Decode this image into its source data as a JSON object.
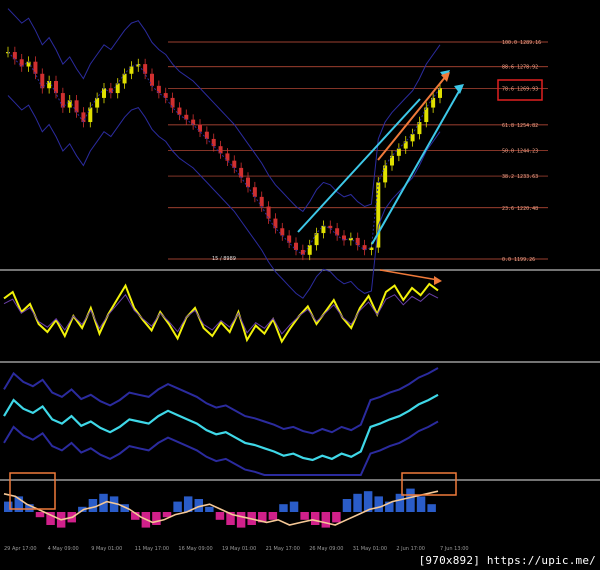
{
  "watermark": "[970x892] https://upic.me/",
  "colors": {
    "background": "#000000",
    "fib_line": "#d2553f",
    "fib_text": "#f4a48a",
    "fib_highlight_box": "#e02020",
    "price_candle_up": "#e0e000",
    "price_candle_down": "#d03030",
    "bollinger": "#2b2b9e",
    "channel_lines": "#3ec8e8",
    "arrow_orange": "#f07a3a",
    "osc_line": "#f2f20a",
    "cyan_line": "#3fd8e8",
    "orange_box": "#f07a3a",
    "panel_divider": "#9a9a9a",
    "hist_blue": "#2a5cc8",
    "hist_magenta": "#d0208a",
    "macd_line": "#f5c896"
  },
  "chart_data": {
    "type": "line",
    "fib_levels": [
      {
        "label": "100.0 1289.16",
        "price": 1289.16
      },
      {
        "label": "88.6 1278.92",
        "price": 1278.92
      },
      {
        "label": "78.6 1269.93",
        "price": 1269.93,
        "highlight": true
      },
      {
        "label": "61.8 1254.82",
        "price": 1254.82
      },
      {
        "label": "50.0 1244.23",
        "price": 1244.23
      },
      {
        "label": "38.2 1233.63",
        "price": 1233.63
      },
      {
        "label": "23.6 1220.48",
        "price": 1220.48
      },
      {
        "label": "0.0 1199.26",
        "price": 1199.26
      }
    ],
    "annotation_text": "15 / 8989",
    "x_labels": [
      "29 Apr 17:00",
      "4 May 09:00",
      "9 May 01:00",
      "11 May 17:00",
      "16 May 09:00",
      "19 May 01:00",
      "21 May 17:00",
      "26 May 09:00",
      "31 May 01:00",
      "2 Jun 17:00",
      "7 Jun 13:00"
    ],
    "price_close": [
      1285,
      1282,
      1279,
      1281,
      1276,
      1270,
      1273,
      1268,
      1262,
      1265,
      1260,
      1256,
      1262,
      1266,
      1270,
      1268,
      1272,
      1276,
      1279,
      1280,
      1276,
      1271,
      1268,
      1266,
      1262,
      1259,
      1257,
      1255,
      1252,
      1249,
      1246,
      1243,
      1240,
      1237,
      1233,
      1229,
      1225,
      1221,
      1216,
      1212,
      1209,
      1206,
      1203,
      1201,
      1205,
      1210,
      1213,
      1212,
      1209,
      1207,
      1208,
      1205,
      1203,
      1204,
      1231,
      1238,
      1242,
      1245,
      1248,
      1251,
      1256,
      1262,
      1266,
      1270
    ],
    "oscillator": [
      0.72,
      0.8,
      0.55,
      0.65,
      0.4,
      0.3,
      0.45,
      0.25,
      0.5,
      0.35,
      0.6,
      0.28,
      0.52,
      0.7,
      0.88,
      0.6,
      0.45,
      0.32,
      0.55,
      0.4,
      0.22,
      0.48,
      0.6,
      0.35,
      0.25,
      0.42,
      0.3,
      0.55,
      0.2,
      0.38,
      0.28,
      0.46,
      0.18,
      0.35,
      0.5,
      0.62,
      0.4,
      0.55,
      0.7,
      0.48,
      0.35,
      0.6,
      0.75,
      0.52,
      0.8,
      0.88,
      0.7,
      0.85,
      0.76,
      0.9,
      0.82
    ],
    "cyan_series": [
      0.55,
      0.7,
      0.62,
      0.58,
      0.64,
      0.52,
      0.48,
      0.55,
      0.46,
      0.5,
      0.44,
      0.4,
      0.45,
      0.52,
      0.5,
      0.48,
      0.55,
      0.6,
      0.56,
      0.52,
      0.48,
      0.42,
      0.38,
      0.4,
      0.35,
      0.3,
      0.28,
      0.25,
      0.22,
      0.18,
      0.2,
      0.16,
      0.14,
      0.18,
      0.15,
      0.2,
      0.17,
      0.22,
      0.45,
      0.48,
      0.52,
      0.55,
      0.6,
      0.66,
      0.7,
      0.75
    ],
    "histogram": [
      0.4,
      0.6,
      0.3,
      -0.2,
      -0.5,
      -0.6,
      -0.4,
      0.2,
      0.5,
      0.7,
      0.6,
      0.3,
      -0.3,
      -0.6,
      -0.5,
      -0.2,
      0.4,
      0.6,
      0.5,
      0.2,
      -0.3,
      -0.5,
      -0.6,
      -0.5,
      -0.4,
      -0.3,
      0.3,
      0.4,
      -0.3,
      -0.5,
      -0.6,
      -0.4,
      0.5,
      0.7,
      0.8,
      0.6,
      0.4,
      0.7,
      0.9,
      0.6,
      0.3
    ],
    "macd_line": [
      0.7,
      0.6,
      0.3,
      0.1,
      -0.1,
      -0.3,
      -0.2,
      0.1,
      0.2,
      0.4,
      0.3,
      0.1,
      -0.2,
      -0.4,
      -0.3,
      -0.1,
      0.0,
      0.2,
      0.3,
      0.1,
      -0.1,
      -0.2,
      -0.3,
      -0.4,
      -0.3,
      -0.5,
      -0.4,
      -0.3,
      -0.4,
      -0.5,
      -0.3,
      -0.1,
      0.1,
      0.2,
      0.4,
      0.5,
      0.6,
      0.7,
      0.8
    ]
  }
}
